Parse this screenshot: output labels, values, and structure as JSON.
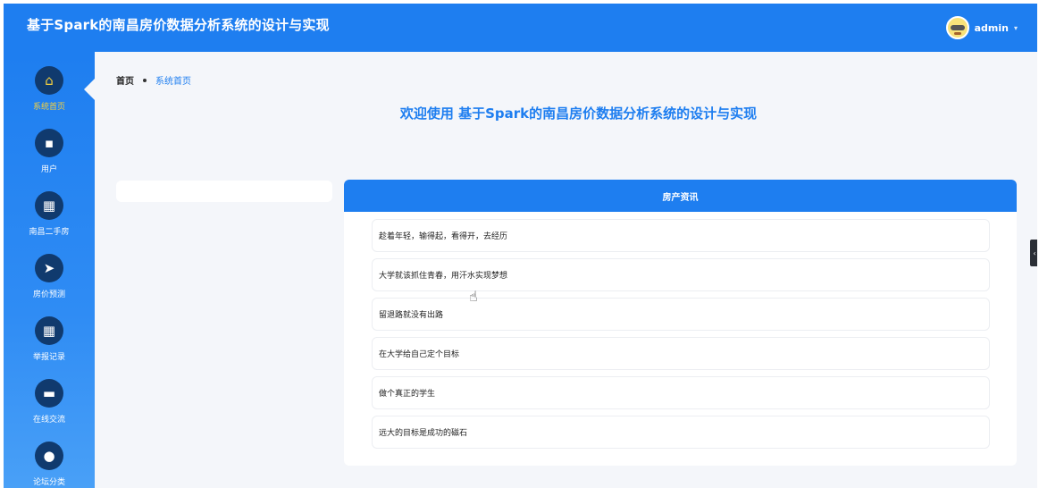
{
  "header": {
    "title": "基于Spark的南昌房价数据分析系统的设计与实现",
    "username": "admin",
    "caret": "▾"
  },
  "sidebar": {
    "items": [
      {
        "label": "系统首页",
        "icon": "home-icon",
        "glyph": "⌂",
        "active": true
      },
      {
        "label": "用户",
        "icon": "chat-icon",
        "glyph": "▪"
      },
      {
        "label": "南昌二手房",
        "icon": "grid-icon",
        "glyph": "▦"
      },
      {
        "label": "房价预测",
        "icon": "paper-plane-icon",
        "glyph": "➤"
      },
      {
        "label": "举报记录",
        "icon": "grid-icon",
        "glyph": "▦"
      },
      {
        "label": "在线交流",
        "icon": "briefcase-icon",
        "glyph": "▬"
      },
      {
        "label": "论坛分类",
        "icon": "bulb-icon",
        "glyph": "●"
      }
    ]
  },
  "breadcrumb": {
    "home": "首页",
    "current": "系统首页"
  },
  "welcome": "欢迎使用 基于Spark的南昌房价数据分析系统的设计与实现",
  "news": {
    "title": "房产资讯",
    "items": [
      "趁着年轻，输得起，看得开，去经历",
      "大学就该抓住青春，用汗水实现梦想",
      "留退路就没有出路",
      "在大学给自己定个目标",
      "做个真正的学生",
      "远大的目标是成功的磁石"
    ]
  },
  "colors": {
    "primary": "#1e7ef0",
    "active_nav": "#f4d03f",
    "nav_circle": "#103a6e"
  }
}
